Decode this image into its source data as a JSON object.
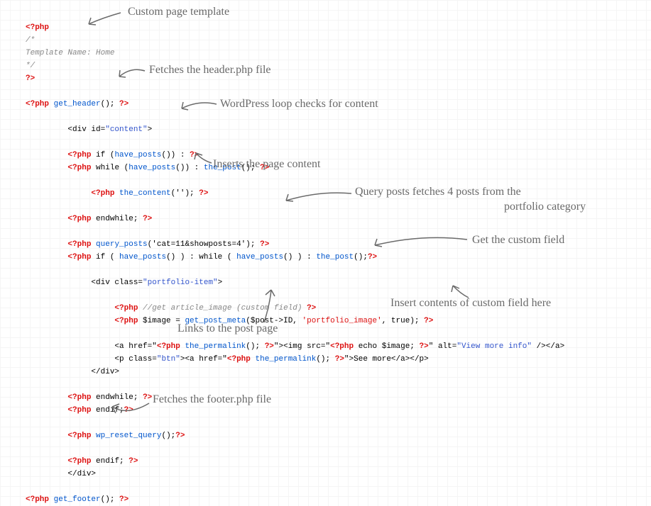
{
  "code": {
    "l1_php": "<?php",
    "l2": "/*",
    "l3": "Template Name: Home",
    "l4": "*/",
    "l5_close": "?>",
    "l7_php": "<?php",
    "l7_fn": " get_header",
    "l7_tail": "(); ",
    "l7_close": "?>",
    "l9_pre": "         <div id=",
    "l9_str": "\"content\"",
    "l9_post": ">",
    "l11_pre": "         ",
    "l11_php": "<?php",
    "l11_txt": " if (",
    "l11_fn": "have_posts",
    "l11_tail": "()) : ",
    "l11_close": "?>",
    "l12_pre": "         ",
    "l12_php": "<?php",
    "l12_txt": " while (",
    "l12_fn": "have_posts",
    "l12_mid": "()) : ",
    "l12_fn2": "the_post",
    "l12_tail": "(); ",
    "l12_close": "?>",
    "l14_pre": "              ",
    "l14_php": "<?php",
    "l14_fn": " the_content",
    "l14_args": "('');",
    "l14_close": " ?>",
    "l16_pre": "         ",
    "l16_php": "<?php",
    "l16_txt": " endwhile; ",
    "l16_close": "?>",
    "l18_pre": "         ",
    "l18_php": "<?php",
    "l18_fn": " query_posts",
    "l18_arg": "('cat=11&showposts=4'); ",
    "l18_close": "?>",
    "l19_pre": "         ",
    "l19_php": "<?php",
    "l19_txt": " if ( ",
    "l19_fn1": "have_posts",
    "l19_mid": "() ) : while ( ",
    "l19_fn2": "have_posts",
    "l19_mid2": "() ) : ",
    "l19_fn3": "the_post",
    "l19_tail": "();",
    "l19_close": "?>",
    "l21_pre": "              <div class=",
    "l21_str": "\"portfolio-item\"",
    "l21_post": ">",
    "l23_pre": "                   ",
    "l23_php": "<?php",
    "l23_cmt": " //get article_image (custom field) ",
    "l23_close": "?>",
    "l24_pre": "                   ",
    "l24_php": "<?php",
    "l24_txt": " $image = ",
    "l24_fn": "get_post_meta",
    "l24_arg1": "($post->ID, ",
    "l24_str": "'portfolio_image'",
    "l24_arg2": ", true); ",
    "l24_close": "?>",
    "l26_pre": "                   <a href=\"",
    "l26_php1": "<?php",
    "l26_fn1": " the_permalink",
    "l26_mid1": "(); ",
    "l26_close1": "?>",
    "l26_mid2": "\"><img src=\"",
    "l26_php2": "<?php",
    "l26_txt2": " echo $image; ",
    "l26_close2": "?>",
    "l26_mid3": "\" alt=",
    "l26_str2": "\"View more info\"",
    "l26_end": " /></a>",
    "l27_pre": "                   <p class=",
    "l27_str": "\"btn\"",
    "l27_mid": "><a href=\"",
    "l27_php": "<?php",
    "l27_fn": " the_permalink",
    "l27_mid2": "(); ",
    "l27_close": "?>",
    "l27_end": "\">See more</a></p>",
    "l28": "              </div>",
    "l30_pre": "         ",
    "l30_php": "<?php",
    "l30_txt": " endwhile; ",
    "l30_close": "?>",
    "l31_pre": "         ",
    "l31_php": "<?php",
    "l31_txt": " endif;",
    "l31_close": "?>",
    "l33_pre": "         ",
    "l33_php": "<?php",
    "l33_fn": " wp_reset_query",
    "l33_tail": "();",
    "l33_close": "?>",
    "l35_pre": "         ",
    "l35_php": "<?php",
    "l35_txt": " endif; ",
    "l35_close": "?>",
    "l36": "         </div>",
    "l38_php": "<?php",
    "l38_fn": " get_footer",
    "l38_tail": "(); ",
    "l38_close": "?>"
  },
  "ann": {
    "a1": "Custom page template",
    "a2": "Fetches the header.php file",
    "a3": "WordPress loop checks for content",
    "a4": "Inserts the page content",
    "a5a": "Query posts fetches 4 posts from the",
    "a5b": "portfolio category",
    "a6": "Get the custom field",
    "a7": "Insert contents of custom field here",
    "a8": "Links to the post page",
    "a9": "Fetches the footer.php file"
  }
}
